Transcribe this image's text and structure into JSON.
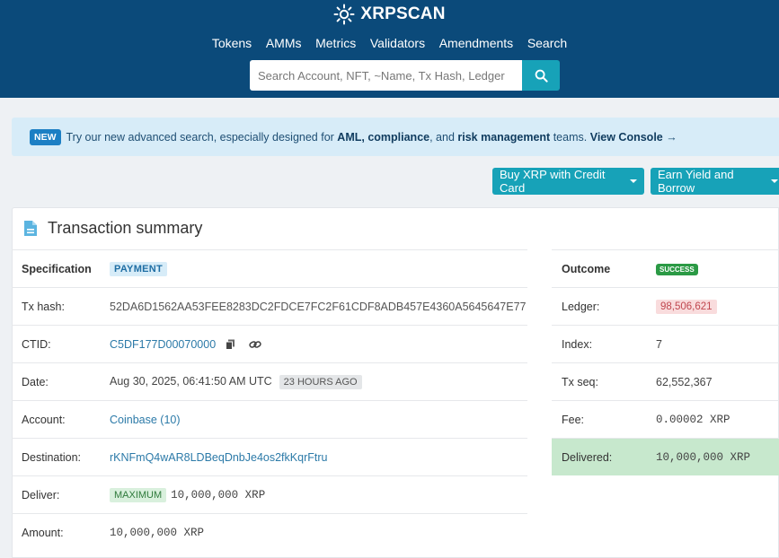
{
  "header": {
    "brand": "XRPSCAN",
    "nav": [
      "Tokens",
      "AMMs",
      "Metrics",
      "Validators",
      "Amendments",
      "Search"
    ],
    "search_placeholder": "Search Account, NFT, ~Name, Tx Hash, Ledger",
    "icons": {
      "logo": "sun-icon",
      "search": "search-icon"
    }
  },
  "banner": {
    "badge": "NEW",
    "text_1": "Try our new advanced search, especially designed for",
    "bold_1": "AML, compliance",
    "text_2": ", and",
    "bold_2": "risk management",
    "text_3": "teams.",
    "cta": "View Console",
    "cta_arrow": "→"
  },
  "buttons": {
    "buy": "Buy XRP with Credit Card",
    "earn": "Earn Yield and Borrow"
  },
  "summary": {
    "title": "Transaction summary",
    "left": {
      "specification": {
        "label": "Specification",
        "value": "PAYMENT"
      },
      "tx_hash": {
        "label": "Tx hash:",
        "value": "52DA6D1562AA53FEE8283DC2FDCE7FC2F61CDF8ADB457E4360A5645647E77"
      },
      "ctid": {
        "label": "CTID:",
        "value": "C5DF177D00070000"
      },
      "date": {
        "label": "Date:",
        "value": "Aug 30, 2025, 06:41:50 AM UTC",
        "badge": "23 HOURS AGO"
      },
      "account": {
        "label": "Account:",
        "value": "Coinbase (10)"
      },
      "destination": {
        "label": "Destination:",
        "value": "rKNFmQ4wAR8LDBeqDnbJe4os2fkKqrFtru"
      },
      "deliver": {
        "label": "Deliver:",
        "badge": "MAXIMUM",
        "value": "10,000,000 XRP"
      },
      "amount": {
        "label": "Amount:",
        "value": "10,000,000 XRP"
      }
    },
    "right": {
      "outcome": {
        "label": "Outcome",
        "value": "SUCCESS"
      },
      "ledger": {
        "label": "Ledger:",
        "value": "98,506,621"
      },
      "index": {
        "label": "Index:",
        "value": "7"
      },
      "tx_seq": {
        "label": "Tx seq:",
        "value": "62,552,367"
      },
      "fee": {
        "label": "Fee:",
        "value": "0.00002 XRP"
      },
      "delivered": {
        "label": "Delivered:",
        "value": "10,000,000 XRP"
      }
    }
  }
}
